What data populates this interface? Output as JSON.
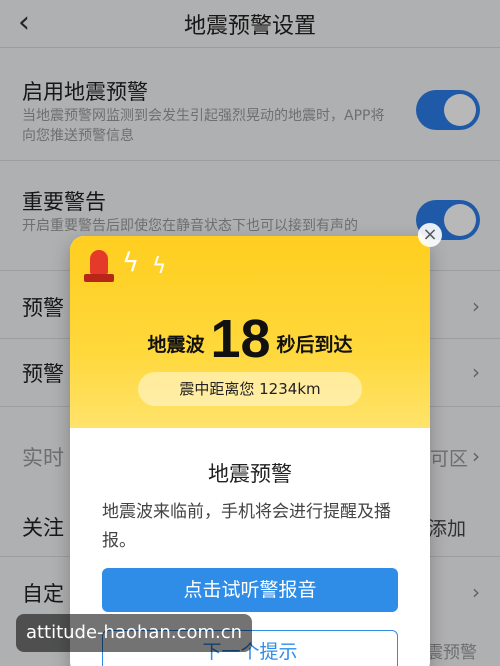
{
  "navbar": {
    "back_icon": "chevron-left-icon",
    "title": "地震预警设置"
  },
  "settings": {
    "enable_warning": {
      "title": "启用地震预警",
      "desc": "当地震预警网监测到会发生引起强烈晃动的地震时，APP将向您推送预警信息",
      "toggle_on": true
    },
    "important_alert": {
      "title": "重要警告",
      "desc": "开启重要警告后即使您在静音状态下也可以接到有声的",
      "toggle_on": true
    },
    "row3_title": "预警",
    "row4_title": "预警",
    "row5_title": "实时",
    "row5_right": "可区",
    "row6_title": "关注",
    "row6_right": "添加",
    "row7_title": "自定",
    "row8_right": "震预警"
  },
  "modal": {
    "wave_prefix": "地震波",
    "seconds": "18",
    "wave_suffix": "秒后到达",
    "distance": "震中距离您 1234km",
    "title": "地震预警",
    "body": "地震波来临前，手机将会进行提醒及播报。",
    "primary_button": "点击试听警报音",
    "secondary_button": "下一个提示",
    "close_icon": "close-icon",
    "siren_icon": "siren-icon",
    "accent_color": "#ffd02a",
    "button_color": "#2f8de8"
  },
  "watermark": "attitude-haohan.com.cn"
}
